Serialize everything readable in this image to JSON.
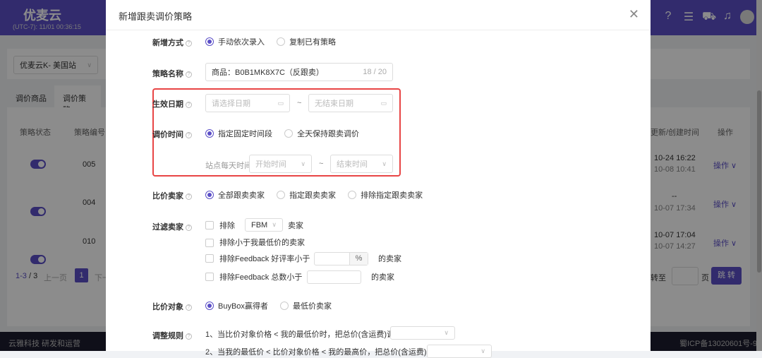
{
  "app": {
    "logo": "优麦云",
    "clock": "(UTC-7): 11/01 00:36:15",
    "header_icons": [
      "help-icon",
      "message-icon",
      "cart-icon",
      "bell-icon",
      "avatar-icon"
    ]
  },
  "page": {
    "store_select": "优麦云K- 美国站",
    "tabs": [
      "调价商品",
      "调价策略"
    ],
    "columns": [
      "策略状态",
      "策略编号",
      "更新/创建时间",
      "操作"
    ],
    "rows": [
      {
        "id": "005",
        "updated": "10-24 16:22",
        "created": "10-08 10:41",
        "action": "操作"
      },
      {
        "id": "004",
        "updated": "--",
        "created": "10-07 17:34",
        "action": "操作"
      },
      {
        "id": "010",
        "updated": "10-07 17:04",
        "created": "10-07 14:27",
        "action": "操作"
      }
    ],
    "pagination": {
      "range": "1-3",
      "total": "/ 3",
      "prev": "上一页",
      "current": "1",
      "next": "下一",
      "goto": "转至",
      "page_unit": "页",
      "jump": "跳 转"
    },
    "footer_left": "云雅科技 研发和运营",
    "footer_right": "蜀ICP备13020601号-9"
  },
  "modal": {
    "title": "新增跟卖调价策略",
    "add_mode": {
      "label": "新增方式",
      "options": [
        "手动依次录入",
        "复制已有策略"
      ]
    },
    "name": {
      "label": "策略名称",
      "value": "商品：B0B1MK8X7C（反跟卖）",
      "count": "18 / 20"
    },
    "date": {
      "label": "生效日期",
      "start_ph": "请选择日期",
      "sep": "~",
      "end_ph": "无结束日期"
    },
    "time": {
      "label": "调价时间",
      "options": [
        "指定固定时间段",
        "全天保持跟卖调价"
      ],
      "daily_label": "站点每天时间",
      "start_ph": "开始时间",
      "end_ph": "结束时间"
    },
    "sellers": {
      "label": "比价卖家",
      "options": [
        "全部跟卖卖家",
        "指定跟卖卖家",
        "排除指定跟卖卖家"
      ]
    },
    "filter": {
      "label": "过滤卖家",
      "exclude": "排除",
      "fbm": "FBM",
      "seller": "卖家",
      "below_min": "排除小于我最低价的卖家",
      "rating": "排除Feedback 好评率小于",
      "percent": "%",
      "of_seller": "的卖家",
      "count": "排除Feedback 总数小于"
    },
    "target": {
      "label": "比价对象",
      "options": [
        "BuyBox赢得者",
        "最低价卖家"
      ]
    },
    "rules": {
      "label": "调整规则",
      "rule1": "1、当比价对象价格 < 我的最低价时，把总价(含运费)调至",
      "rule2": "2、当我的最低价 < 比价对象价格 < 我的最高价，把总价(含运费)调至"
    }
  },
  "colors": {
    "accent": "#5b4fc7",
    "highlight": "#e84545"
  }
}
